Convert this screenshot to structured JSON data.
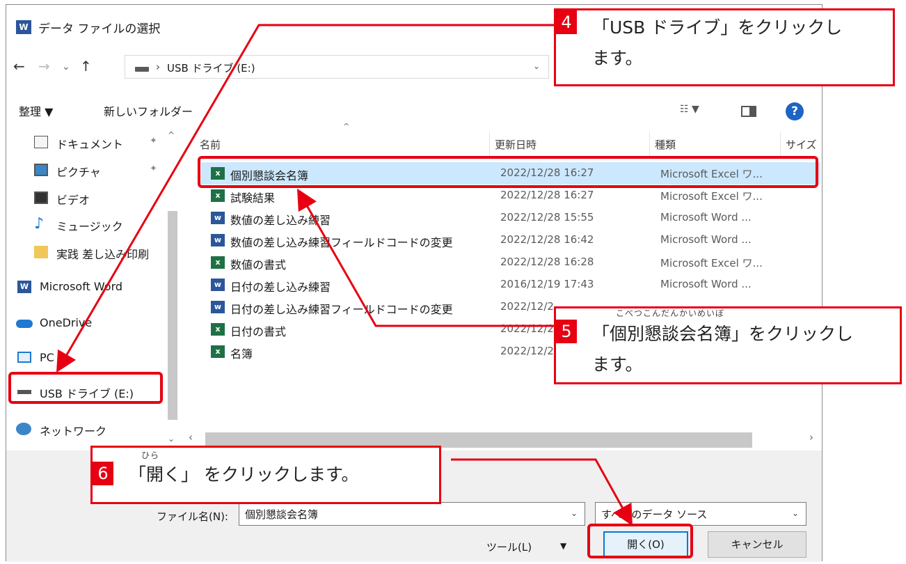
{
  "window": {
    "title": "データ ファイルの選択",
    "app_icon": "W"
  },
  "address": {
    "path": "USB ドライブ (E:)"
  },
  "toolbar": {
    "organize": "整理 ▼",
    "new_folder": "新しいフォルダー"
  },
  "nav": {
    "items": [
      {
        "label": "ドキュメント",
        "icon": "document-icon"
      },
      {
        "label": "ピクチャ",
        "icon": "picture-icon"
      },
      {
        "label": "ビデオ",
        "icon": "video-icon"
      },
      {
        "label": "ミュージック",
        "icon": "music-icon"
      },
      {
        "label": "実践 差し込み印刷",
        "icon": "folder-icon"
      },
      {
        "label": "Microsoft Word",
        "icon": "word-icon"
      },
      {
        "label": "OneDrive",
        "icon": "onedrive-icon"
      },
      {
        "label": "PC",
        "icon": "pc-icon"
      },
      {
        "label": "USB ドライブ (E:)",
        "icon": "usb-drive-icon"
      },
      {
        "label": "ネットワーク",
        "icon": "network-icon"
      }
    ]
  },
  "columns": {
    "name": "名前",
    "modified": "更新日時",
    "type": "種類",
    "size": "サイズ"
  },
  "files": [
    {
      "name": "個別懇談会名簿",
      "date": "2022/12/28 16:27",
      "type": "Microsoft Excel ワ...",
      "kind": "excel"
    },
    {
      "name": "試験結果",
      "date": "2022/12/28 16:27",
      "type": "Microsoft Excel ワ...",
      "kind": "excel"
    },
    {
      "name": "数値の差し込み練習",
      "date": "2022/12/28 15:55",
      "type": "Microsoft Word ...",
      "kind": "word"
    },
    {
      "name": "数値の差し込み練習フィールドコードの変更",
      "date": "2022/12/28 16:42",
      "type": "Microsoft Word ...",
      "kind": "word"
    },
    {
      "name": "数値の書式",
      "date": "2022/12/28 16:28",
      "type": "Microsoft Excel ワ...",
      "kind": "excel"
    },
    {
      "name": "日付の差し込み練習",
      "date": "2016/12/19 17:43",
      "type": "Microsoft Word ...",
      "kind": "word"
    },
    {
      "name": "日付の差し込み練習フィールドコードの変更",
      "date": "2022/12/2",
      "type": "",
      "kind": "word"
    },
    {
      "name": "日付の書式",
      "date": "2022/12/2",
      "type": "",
      "kind": "excel"
    },
    {
      "name": "名簿",
      "date": "2022/12/2",
      "type": "",
      "kind": "excel"
    }
  ],
  "bottom": {
    "filename_label": "ファイル名(N):",
    "filename_value": "個別懇談会名簿",
    "filetype_value": "すべてのデータ ソース",
    "tools": "ツール(L)",
    "open": "開く(O)",
    "cancel": "キャンセル"
  },
  "callouts": {
    "c4": {
      "num": "4",
      "line1": "「USB ドライブ」をクリックし",
      "line2": "ます。"
    },
    "c5": {
      "num": "5",
      "ruby": "こべつこんだんかいめいぼ",
      "line1": "「個別懇談会名簿」をクリックし",
      "line2": "ます。"
    },
    "c6": {
      "num": "6",
      "ruby": "ひら",
      "line1": "「開く」 をクリックします。"
    }
  },
  "colors": {
    "annotation": "#e60012",
    "selection": "#cce8ff",
    "accent": "#0078d7"
  }
}
